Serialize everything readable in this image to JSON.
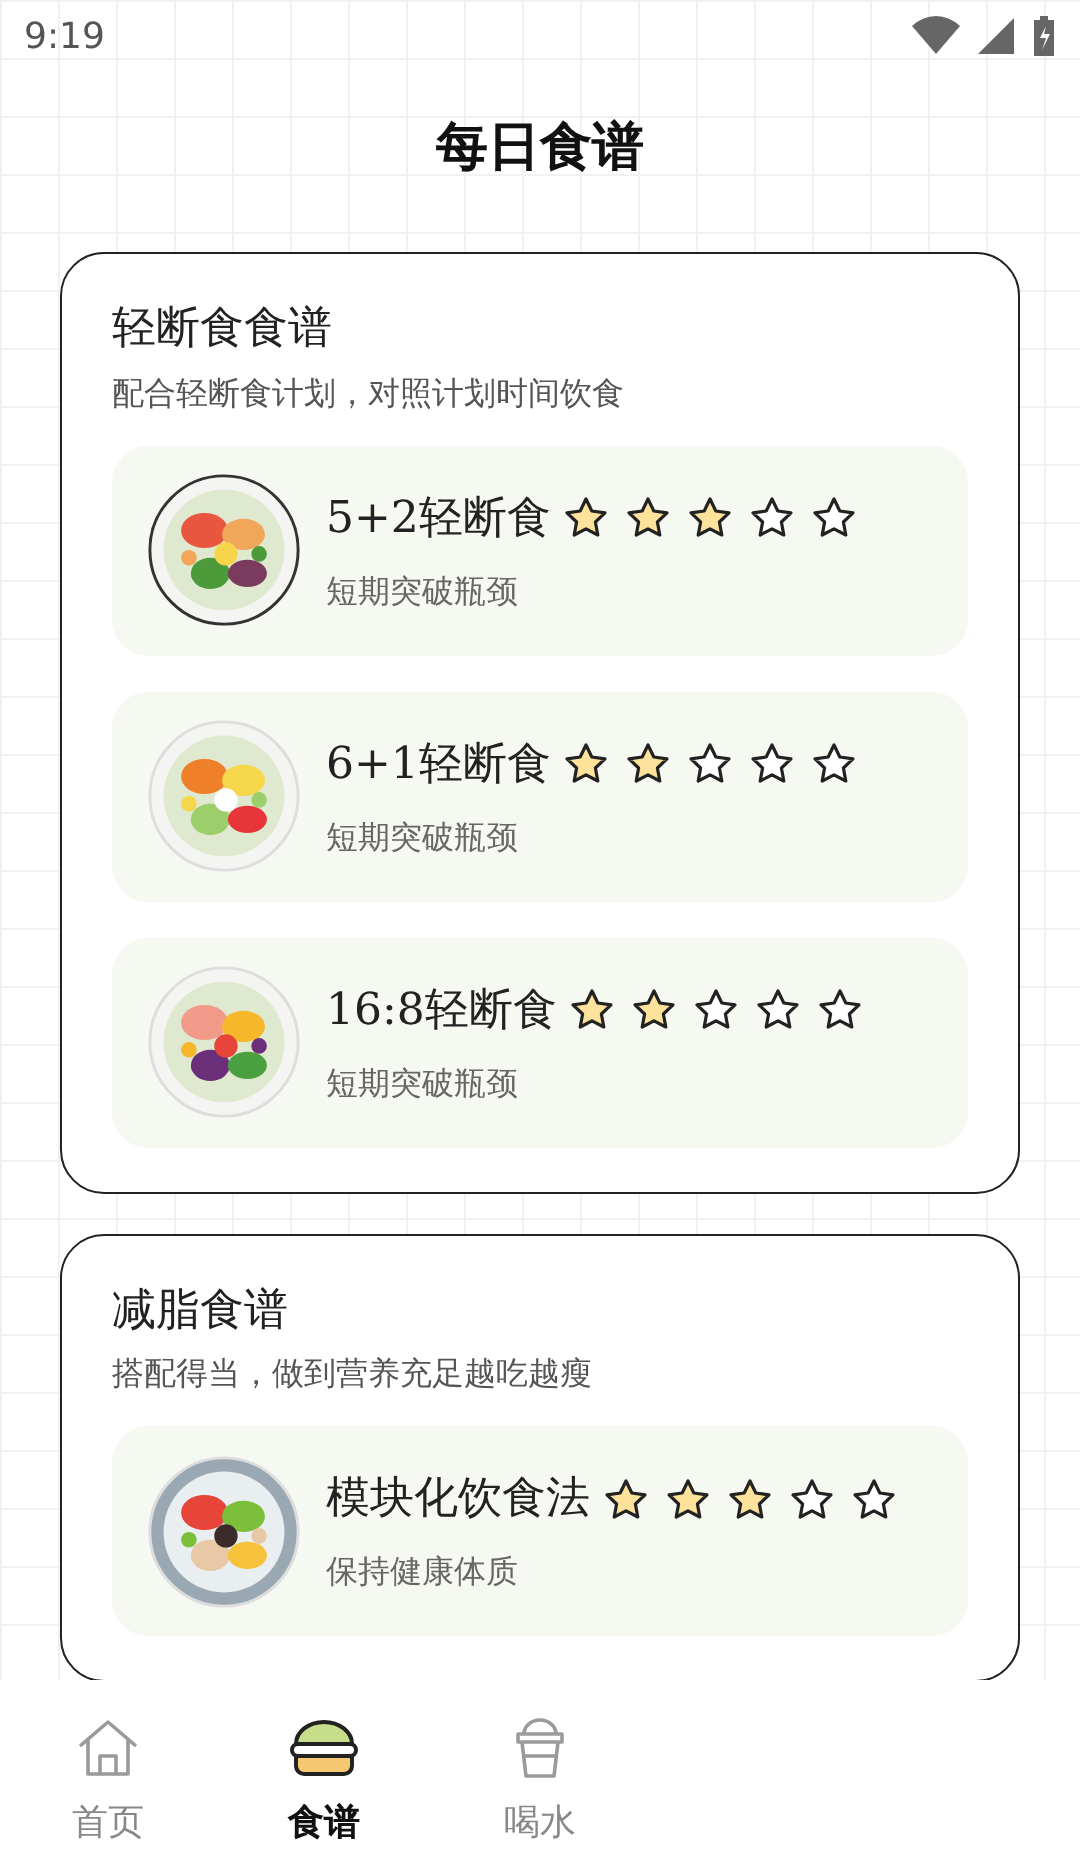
{
  "status_bar": {
    "time": "9:19"
  },
  "title": "每日食谱",
  "sections": [
    {
      "title": "轻断食食谱",
      "subtitle": "配合轻断食计划，对照计划时间饮食",
      "recipes": [
        {
          "name": "5+2轻断食",
          "stars": 3,
          "note": "短期突破瓶颈"
        },
        {
          "name": "6+1轻断食",
          "stars": 2,
          "note": "短期突破瓶颈"
        },
        {
          "name": "16:8轻断食",
          "stars": 2,
          "note": "短期突破瓶颈"
        }
      ]
    },
    {
      "title": "减脂食谱",
      "subtitle": "搭配得当，做到营养充足越吃越瘦",
      "recipes": [
        {
          "name": "模块化饮食法",
          "stars": 3,
          "note": "保持健康体质"
        }
      ]
    }
  ],
  "nav": [
    {
      "kind": "home",
      "label": "首页",
      "selected": false
    },
    {
      "kind": "burger",
      "label": "食谱",
      "selected": true
    },
    {
      "kind": "cup",
      "label": "喝水",
      "selected": false
    }
  ]
}
